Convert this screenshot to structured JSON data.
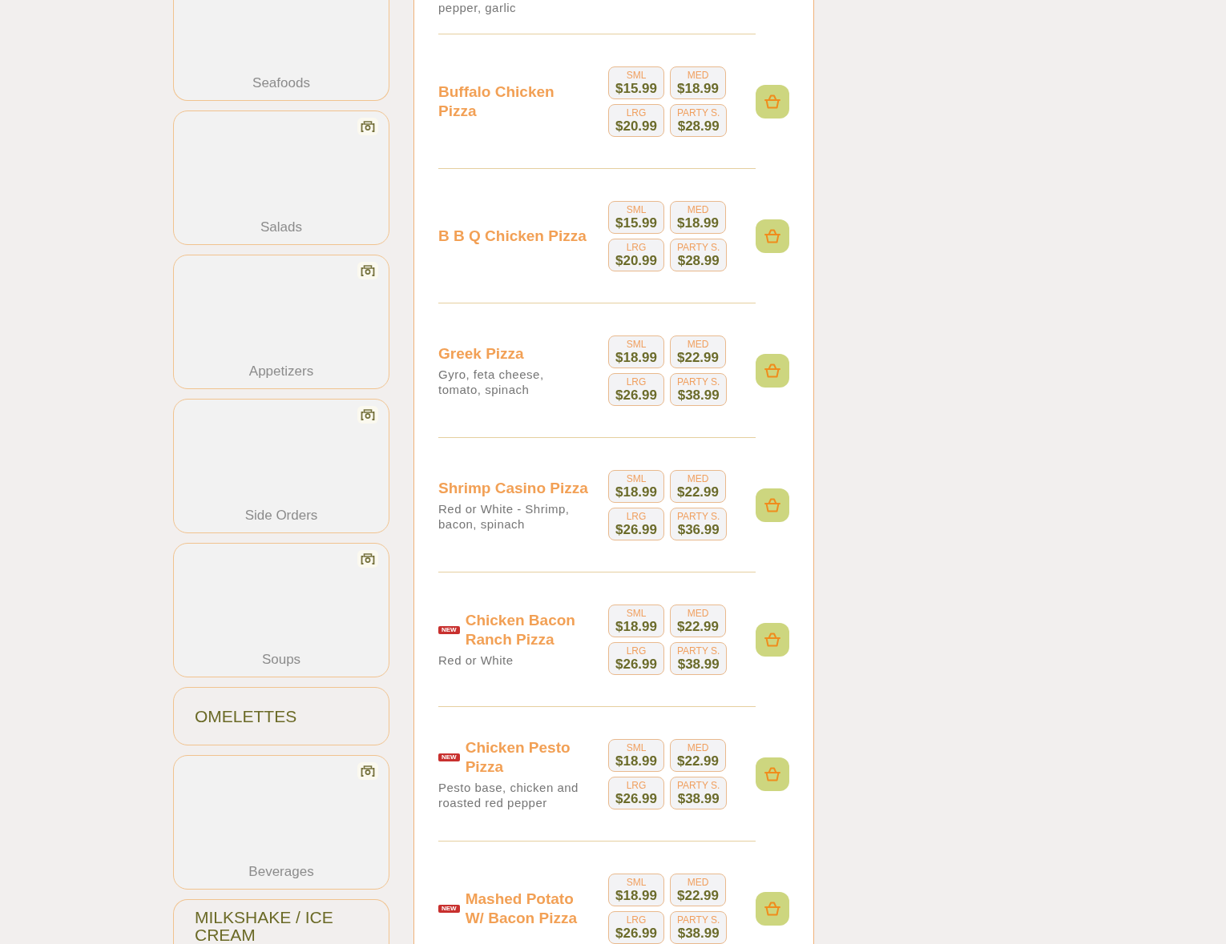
{
  "categories": [
    {
      "label": "Seafoods",
      "kind": "photo"
    },
    {
      "label": "Salads",
      "kind": "photo"
    },
    {
      "label": "Appetizers",
      "kind": "photo"
    },
    {
      "label": "Side Orders",
      "kind": "photo"
    },
    {
      "label": "Soups",
      "kind": "photo"
    },
    {
      "label": "OMELETTES",
      "kind": "text"
    },
    {
      "label": "Beverages",
      "kind": "photo"
    },
    {
      "label": "MILKSHAKE / ICE CREAM",
      "kind": "text"
    }
  ],
  "menu": {
    "cut_off_description": "pepper, garlic",
    "items": [
      {
        "name": "Buffalo Chicken Pizza",
        "prices": [
          {
            "size": "SML",
            "price": "$15.99"
          },
          {
            "size": "MED",
            "price": "$18.99"
          },
          {
            "size": "LRG",
            "price": "$20.99"
          },
          {
            "size": "PARTY S.",
            "price": "$28.99"
          }
        ]
      },
      {
        "name": "B B Q Chicken Pizza",
        "prices": [
          {
            "size": "SML",
            "price": "$15.99"
          },
          {
            "size": "MED",
            "price": "$18.99"
          },
          {
            "size": "LRG",
            "price": "$20.99"
          },
          {
            "size": "PARTY S.",
            "price": "$28.99"
          }
        ]
      },
      {
        "name": "Greek Pizza",
        "description": "Gyro, feta cheese, tomato, spinach",
        "prices": [
          {
            "size": "SML",
            "price": "$18.99"
          },
          {
            "size": "MED",
            "price": "$22.99"
          },
          {
            "size": "LRG",
            "price": "$26.99"
          },
          {
            "size": "PARTY S.",
            "price": "$38.99"
          }
        ]
      },
      {
        "name": "Shrimp Casino Pizza",
        "description": "Red or White - Shrimp, bacon, spinach",
        "prices": [
          {
            "size": "SML",
            "price": "$18.99"
          },
          {
            "size": "MED",
            "price": "$22.99"
          },
          {
            "size": "LRG",
            "price": "$26.99"
          },
          {
            "size": "PARTY S.",
            "price": "$36.99"
          }
        ]
      },
      {
        "badge": "NEW",
        "name": "Chicken Bacon Ranch Pizza",
        "description": "Red or White",
        "prices": [
          {
            "size": "SML",
            "price": "$18.99"
          },
          {
            "size": "MED",
            "price": "$22.99"
          },
          {
            "size": "LRG",
            "price": "$26.99"
          },
          {
            "size": "PARTY S.",
            "price": "$38.99"
          }
        ]
      },
      {
        "badge": "NEW",
        "name": "Chicken Pesto Pizza",
        "description": "Pesto base, chicken and roasted red pepper",
        "prices": [
          {
            "size": "SML",
            "price": "$18.99"
          },
          {
            "size": "MED",
            "price": "$22.99"
          },
          {
            "size": "LRG",
            "price": "$26.99"
          },
          {
            "size": "PARTY S.",
            "price": "$38.99"
          }
        ]
      },
      {
        "badge": "NEW",
        "name": "Mashed Potato W/ Bacon Pizza",
        "prices": [
          {
            "size": "SML",
            "price": "$18.99"
          },
          {
            "size": "MED",
            "price": "$22.99"
          },
          {
            "size": "LRG",
            "price": "$26.99"
          },
          {
            "size": "PARTY S.",
            "price": "$38.99"
          }
        ]
      }
    ]
  }
}
